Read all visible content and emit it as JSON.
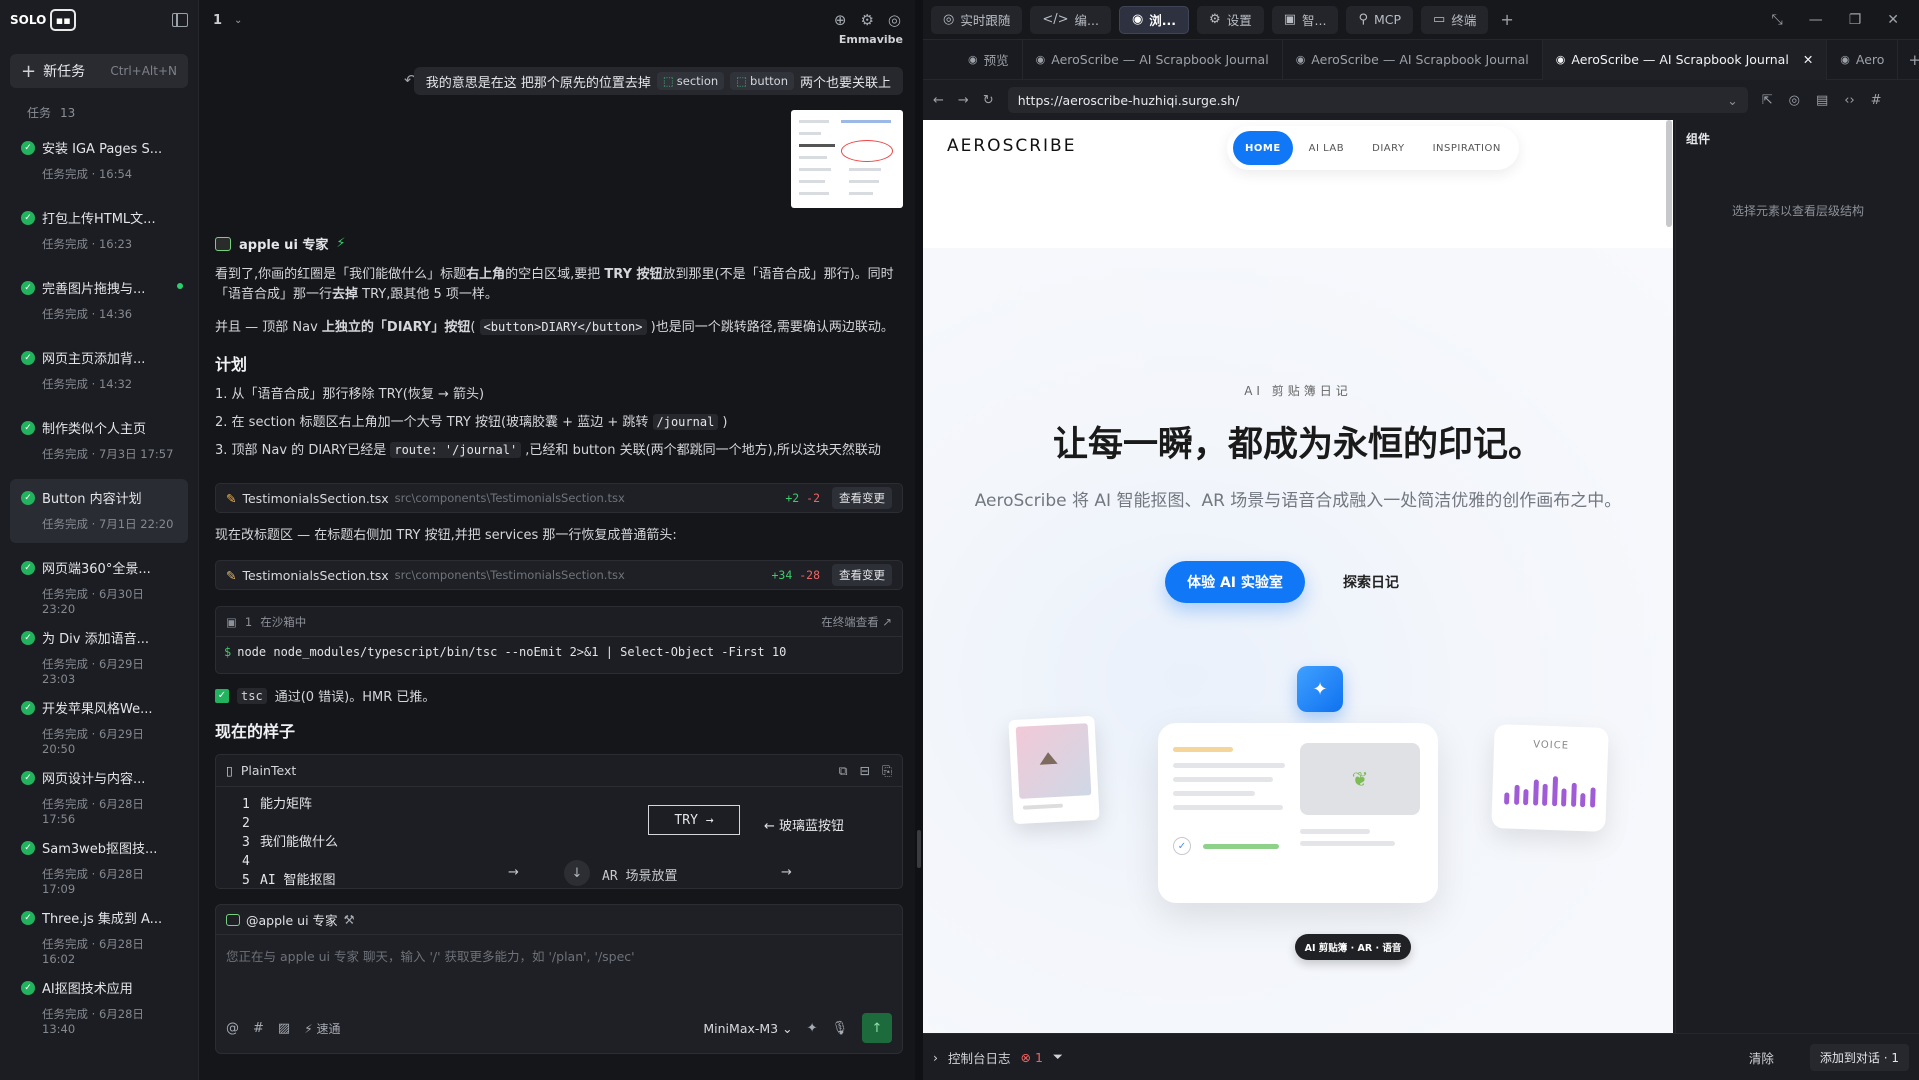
{
  "sidebar": {
    "logo": "SOLO",
    "new_task_label": "新任务",
    "new_task_hotkey": "Ctrl+Alt+N",
    "tasks_label": "任务",
    "tasks_count": "13",
    "tasks": [
      {
        "title": "安装 IGA Pages S...",
        "status": "任务完成 · 16:54"
      },
      {
        "title": "打包上传HTML文...",
        "status": "任务完成 · 16:23"
      },
      {
        "title": "完善图片拖拽与...",
        "status": "任务完成 · 14:36"
      },
      {
        "title": "网页主页添加背...",
        "status": "任务完成 · 14:32"
      },
      {
        "title": "制作类似个人主页",
        "status": "任务完成 · 7月3日 17:57"
      },
      {
        "title": "Button 内容计划",
        "status": "任务完成 · 7月1日 22:20"
      },
      {
        "title": "网页端360°全景...",
        "status": "任务完成 · 6月30日 23:20"
      },
      {
        "title": "为 Div 添加语音...",
        "status": "任务完成 · 6月29日 23:03"
      },
      {
        "title": "开发苹果风格We...",
        "status": "任务完成 · 6月29日 20:50"
      },
      {
        "title": "网页设计与内容...",
        "status": "任务完成 · 6月28日 17:56"
      },
      {
        "title": "Sam3web抠图技...",
        "status": "任务完成 · 6月28日 17:09"
      },
      {
        "title": "Three.js 集成到 A...",
        "status": "任务完成 · 6月28日 16:02"
      },
      {
        "title": "AI抠图技术应用",
        "status": "任务完成 · 6月28日 13:40"
      }
    ]
  },
  "chat": {
    "session": "1",
    "user_name": "Emmavibe",
    "user_message_pre": "我的意思是在这 把那个原先的位置去掉",
    "chip1": "section",
    "chip2": "button",
    "user_message_post": "两个也要关联上",
    "ai_name": "apple ui 专家",
    "p1a": "看到了,你画的红圈是「我们能做什么」标题",
    "p1b": "右上角",
    "p1c": "的空白区域,要把 ",
    "p1d": "TRY 按钮",
    "p1e": "放到那里(不是「语音合成」那行)。同时「语音合成」那一行",
    "p1f": "去掉",
    "p1g": " TRY,跟其他 5 项一样。",
    "p2a": "并且 — 顶部 Nav ",
    "p2b": "上独立的「DIARY」按钮",
    "p2c": "( ",
    "p2code": "<button>DIARY</button>",
    "p2d": " )也是同一个跳转路径,需要确认两边联动。",
    "plan_title": "计划",
    "plan1": "1. 从「语音合成」那行移除 TRY(恢复 → 箭头)",
    "plan2a": "2. 在 section 标题区右上角加一个大号 TRY 按钮(玻璃胶囊 + 蓝边 + 跳转 ",
    "plan2code": "/journal",
    "plan2b": " )",
    "plan3a": "3. 顶部 Nav 的 DIARY已经是 ",
    "plan3code": "route: '/journal'",
    "plan3b": " ,已经和 button 关联(两个都跳同一个地方),所以这块天然联动",
    "file1_name": "TestimonialsSection.tsx",
    "file1_path": "src\\components\\TestimonialsSection.tsx",
    "file1_add": "+2",
    "file1_del": "-2",
    "view_label": "查看变更",
    "p3": "现在改标题区 — 在标题右侧加 TRY 按钮,并把 services 那一行恢复成普通箭头:",
    "file2_name": "TestimonialsSection.tsx",
    "file2_path": "src\\components\\TestimonialsSection.tsx",
    "file2_add": "+34",
    "file2_del": "-28",
    "term_id": "1",
    "term_status": "在沙箱中",
    "term_link": "在终端查看",
    "term_cmd": "node node_modules/typescript/bin/tsc --noEmit 2>&1 | Select-Object -First 10",
    "ok_code": "tsc",
    "ok_text": "通过(0 错误)。HMR 已推。",
    "now_title": "现在的样子",
    "code_lang": "PlainText",
    "code_lines": [
      {
        "n": "1",
        "t": "能力矩阵"
      },
      {
        "n": "2",
        "t": ""
      },
      {
        "n": "3",
        "t": "我们能做什么"
      },
      {
        "n": "4",
        "t": ""
      },
      {
        "n": "5",
        "t": "AI 智能抠图"
      }
    ],
    "try_label": "TRY",
    "try_note": "← 玻璃蓝按钮",
    "ar_label": "AR 场景放置",
    "composer_agent": "@apple ui 专家",
    "composer_placeholder": "您正在与 apple ui 专家 聊天，输入 '/' 获取更多能力，如 '/plan', '/spec'",
    "speed_label": "速通",
    "model": "MiniMax-M3"
  },
  "browser": {
    "top_buttons": [
      {
        "label": "实时跟随",
        "icon": "◎"
      },
      {
        "label": "编...",
        "icon": "</>"
      },
      {
        "label": "浏...",
        "icon": "◉"
      },
      {
        "label": "设置",
        "icon": "⚙"
      },
      {
        "label": "智...",
        "icon": "▣"
      },
      {
        "label": "MCP",
        "icon": "⚲"
      },
      {
        "label": "终端",
        "icon": "▭"
      }
    ],
    "tabs": [
      {
        "label": "预览"
      },
      {
        "label": "AeroScribe — AI Scrapbook Journal"
      },
      {
        "label": "AeroScribe — AI Scrapbook Journal"
      },
      {
        "label": "AeroScribe — AI Scrapbook Journal"
      },
      {
        "label": "Aero"
      }
    ],
    "url": "https://aeroscribe-huzhiqi.surge.sh/",
    "site": {
      "brand": "AEROSCRIBE",
      "nav": [
        "HOME",
        "AI LAB",
        "DIARY",
        "INSPIRATION"
      ],
      "eyebrow": "AI 剪贴簿日记",
      "headline": "让每一瞬，都成为永恒的印记。",
      "subtitle": "AeroScribe 将 AI 智能抠图、AR 场景与语音合成融入一处简洁优雅的创作画布之中。",
      "cta_primary": "体验 AI 实验室",
      "cta_secondary": "探索日记",
      "voice_label": "VOICE",
      "badge": "AI 剪贴簿 · AR · 语音"
    },
    "inspector_title": "组件",
    "inspector_empty": "选择元素以查看层级结构",
    "console_label": "控制台日志",
    "console_errors": "1",
    "clear_label": "清除",
    "add_to_chat": "添加到对话 · 1"
  },
  "colors": {
    "accent": "#1077f6",
    "success": "#22b35e",
    "error": "#f06262",
    "voice_bars": "#a05cd6"
  }
}
